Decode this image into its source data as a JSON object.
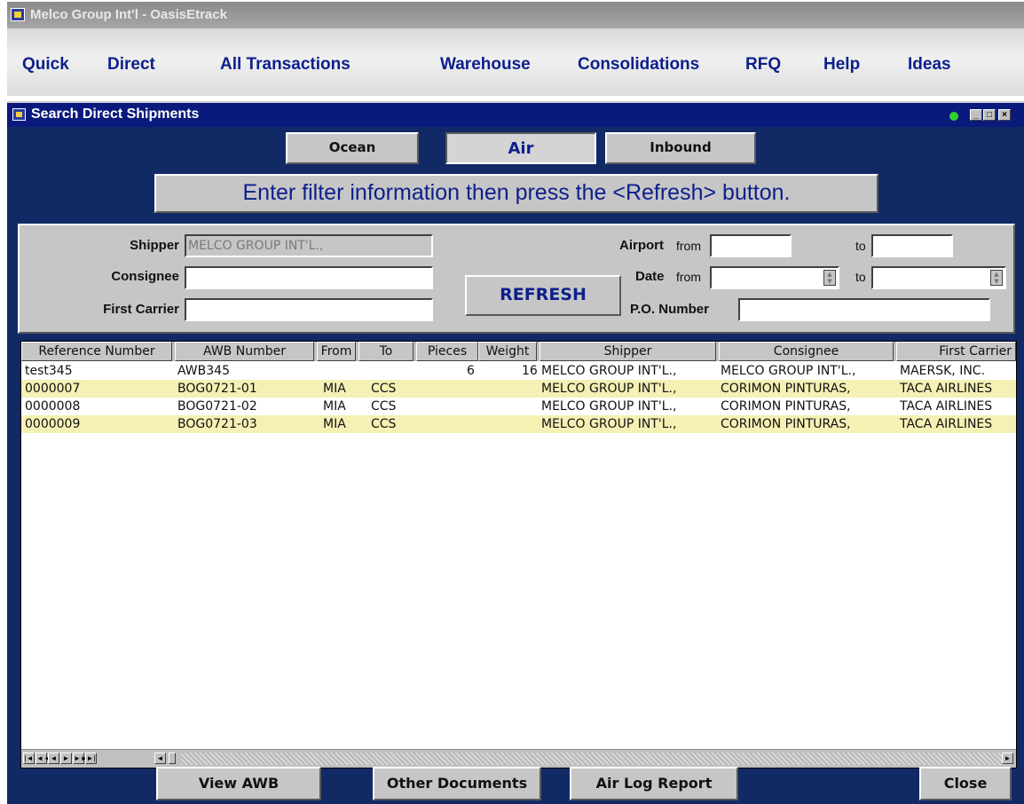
{
  "app": {
    "title": "Melco Group Int'l - OasisEtrack"
  },
  "menu": [
    "Quick",
    "Direct",
    "All Transactions",
    "Warehouse",
    "Consolidations",
    "RFQ",
    "Help",
    "Ideas"
  ],
  "window": {
    "title": "Search Direct Shipments"
  },
  "tabs": {
    "ocean": "Ocean",
    "air": "Air",
    "inbound": "Inbound",
    "active": "Air"
  },
  "instruction": "Enter filter information then press the <Refresh> button.",
  "filters": {
    "shipper_label": "Shipper",
    "shipper_value": "MELCO GROUP INT'L.,",
    "consignee_label": "Consignee",
    "consignee_value": "",
    "first_carrier_label": "First Carrier",
    "first_carrier_value": "",
    "airport_label": "Airport",
    "from_label": "from",
    "to_label": "to",
    "date_label": "Date",
    "po_label": "P.O. Number",
    "refresh_label": "REFRESH"
  },
  "grid": {
    "columns": [
      "Reference Number",
      "AWB Number",
      "From",
      "To",
      "Pieces",
      "Weight",
      "Shipper",
      "Consignee",
      "First Carrier"
    ],
    "rows": [
      {
        "ref": "test345",
        "awb": "AWB345",
        "from": "",
        "to": "",
        "pieces": "6",
        "weight": "16",
        "shipper": "MELCO GROUP INT'L.,",
        "consignee": "MELCO GROUP INT'L.,",
        "carrier": "MAERSK, INC."
      },
      {
        "ref": "0000007",
        "awb": "BOG0721-01",
        "from": "MIA",
        "to": "CCS",
        "pieces": "",
        "weight": "",
        "shipper": "MELCO GROUP INT'L.,",
        "consignee": "CORIMON  PINTURAS,",
        "carrier": "TACA AIRLINES"
      },
      {
        "ref": "0000008",
        "awb": "BOG0721-02",
        "from": "MIA",
        "to": "CCS",
        "pieces": "",
        "weight": "",
        "shipper": "MELCO GROUP INT'L.,",
        "consignee": "CORIMON  PINTURAS,",
        "carrier": "TACA AIRLINES"
      },
      {
        "ref": "0000009",
        "awb": "BOG0721-03",
        "from": "MIA",
        "to": "CCS",
        "pieces": "",
        "weight": "",
        "shipper": "MELCO GROUP INT'L.,",
        "consignee": "CORIMON  PINTURAS,",
        "carrier": "TACA AIRLINES"
      }
    ]
  },
  "actions": {
    "view_awb": "View AWB",
    "other_documents": "Other Documents",
    "air_log_report": "Air Log Report",
    "close": "Close"
  },
  "colors": {
    "window_bg": "#112a66",
    "title_bar": "#0a1a7c",
    "accent_text": "#0d1f8c",
    "row_highlight": "#f5f0b4",
    "status_led": "#30d030"
  }
}
